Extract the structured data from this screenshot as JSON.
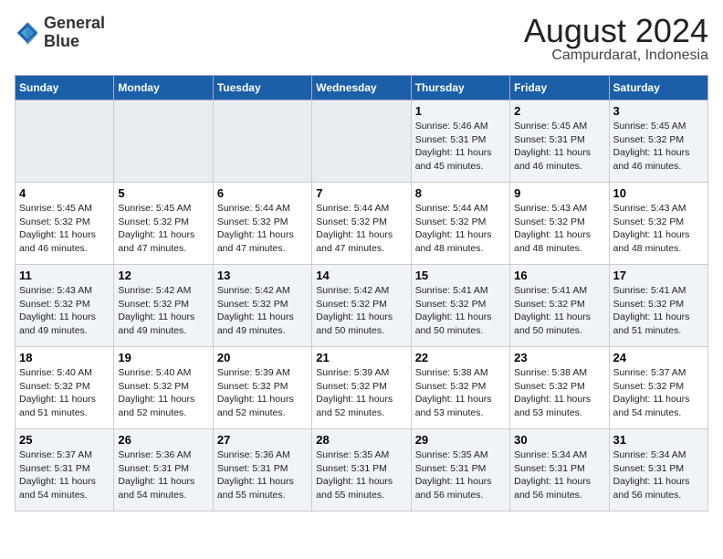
{
  "header": {
    "logo_line1": "General",
    "logo_line2": "Blue",
    "main_title": "August 2024",
    "subtitle": "Campurdarat, Indonesia"
  },
  "days_of_week": [
    "Sunday",
    "Monday",
    "Tuesday",
    "Wednesday",
    "Thursday",
    "Friday",
    "Saturday"
  ],
  "weeks": [
    [
      {
        "day": "",
        "info": ""
      },
      {
        "day": "",
        "info": ""
      },
      {
        "day": "",
        "info": ""
      },
      {
        "day": "",
        "info": ""
      },
      {
        "day": "1",
        "info": "Sunrise: 5:46 AM\nSunset: 5:31 PM\nDaylight: 11 hours and 45 minutes."
      },
      {
        "day": "2",
        "info": "Sunrise: 5:45 AM\nSunset: 5:31 PM\nDaylight: 11 hours and 46 minutes."
      },
      {
        "day": "3",
        "info": "Sunrise: 5:45 AM\nSunset: 5:32 PM\nDaylight: 11 hours and 46 minutes."
      }
    ],
    [
      {
        "day": "4",
        "info": "Sunrise: 5:45 AM\nSunset: 5:32 PM\nDaylight: 11 hours and 46 minutes."
      },
      {
        "day": "5",
        "info": "Sunrise: 5:45 AM\nSunset: 5:32 PM\nDaylight: 11 hours and 47 minutes."
      },
      {
        "day": "6",
        "info": "Sunrise: 5:44 AM\nSunset: 5:32 PM\nDaylight: 11 hours and 47 minutes."
      },
      {
        "day": "7",
        "info": "Sunrise: 5:44 AM\nSunset: 5:32 PM\nDaylight: 11 hours and 47 minutes."
      },
      {
        "day": "8",
        "info": "Sunrise: 5:44 AM\nSunset: 5:32 PM\nDaylight: 11 hours and 48 minutes."
      },
      {
        "day": "9",
        "info": "Sunrise: 5:43 AM\nSunset: 5:32 PM\nDaylight: 11 hours and 48 minutes."
      },
      {
        "day": "10",
        "info": "Sunrise: 5:43 AM\nSunset: 5:32 PM\nDaylight: 11 hours and 48 minutes."
      }
    ],
    [
      {
        "day": "11",
        "info": "Sunrise: 5:43 AM\nSunset: 5:32 PM\nDaylight: 11 hours and 49 minutes."
      },
      {
        "day": "12",
        "info": "Sunrise: 5:42 AM\nSunset: 5:32 PM\nDaylight: 11 hours and 49 minutes."
      },
      {
        "day": "13",
        "info": "Sunrise: 5:42 AM\nSunset: 5:32 PM\nDaylight: 11 hours and 49 minutes."
      },
      {
        "day": "14",
        "info": "Sunrise: 5:42 AM\nSunset: 5:32 PM\nDaylight: 11 hours and 50 minutes."
      },
      {
        "day": "15",
        "info": "Sunrise: 5:41 AM\nSunset: 5:32 PM\nDaylight: 11 hours and 50 minutes."
      },
      {
        "day": "16",
        "info": "Sunrise: 5:41 AM\nSunset: 5:32 PM\nDaylight: 11 hours and 50 minutes."
      },
      {
        "day": "17",
        "info": "Sunrise: 5:41 AM\nSunset: 5:32 PM\nDaylight: 11 hours and 51 minutes."
      }
    ],
    [
      {
        "day": "18",
        "info": "Sunrise: 5:40 AM\nSunset: 5:32 PM\nDaylight: 11 hours and 51 minutes."
      },
      {
        "day": "19",
        "info": "Sunrise: 5:40 AM\nSunset: 5:32 PM\nDaylight: 11 hours and 52 minutes."
      },
      {
        "day": "20",
        "info": "Sunrise: 5:39 AM\nSunset: 5:32 PM\nDaylight: 11 hours and 52 minutes."
      },
      {
        "day": "21",
        "info": "Sunrise: 5:39 AM\nSunset: 5:32 PM\nDaylight: 11 hours and 52 minutes."
      },
      {
        "day": "22",
        "info": "Sunrise: 5:38 AM\nSunset: 5:32 PM\nDaylight: 11 hours and 53 minutes."
      },
      {
        "day": "23",
        "info": "Sunrise: 5:38 AM\nSunset: 5:32 PM\nDaylight: 11 hours and 53 minutes."
      },
      {
        "day": "24",
        "info": "Sunrise: 5:37 AM\nSunset: 5:32 PM\nDaylight: 11 hours and 54 minutes."
      }
    ],
    [
      {
        "day": "25",
        "info": "Sunrise: 5:37 AM\nSunset: 5:31 PM\nDaylight: 11 hours and 54 minutes."
      },
      {
        "day": "26",
        "info": "Sunrise: 5:36 AM\nSunset: 5:31 PM\nDaylight: 11 hours and 54 minutes."
      },
      {
        "day": "27",
        "info": "Sunrise: 5:36 AM\nSunset: 5:31 PM\nDaylight: 11 hours and 55 minutes."
      },
      {
        "day": "28",
        "info": "Sunrise: 5:35 AM\nSunset: 5:31 PM\nDaylight: 11 hours and 55 minutes."
      },
      {
        "day": "29",
        "info": "Sunrise: 5:35 AM\nSunset: 5:31 PM\nDaylight: 11 hours and 56 minutes."
      },
      {
        "day": "30",
        "info": "Sunrise: 5:34 AM\nSunset: 5:31 PM\nDaylight: 11 hours and 56 minutes."
      },
      {
        "day": "31",
        "info": "Sunrise: 5:34 AM\nSunset: 5:31 PM\nDaylight: 11 hours and 56 minutes."
      }
    ]
  ]
}
